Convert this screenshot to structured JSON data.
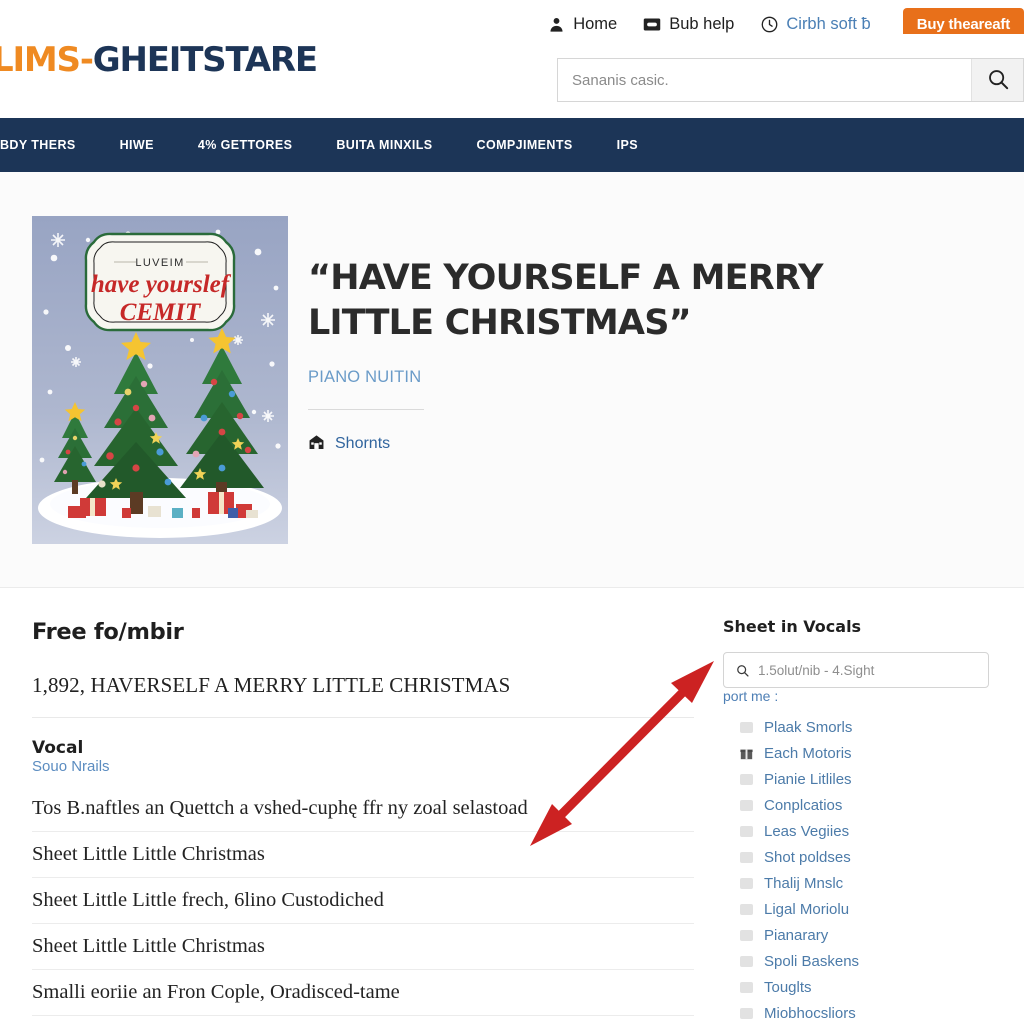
{
  "topbar": {
    "items": [
      {
        "icon": "user-icon",
        "label": "Home",
        "style": "dark"
      },
      {
        "icon": "inbox-icon",
        "label": "Bub help",
        "style": "dark"
      },
      {
        "icon": "clock-icon",
        "label": "Cirbh soft ƀ",
        "style": "link"
      }
    ],
    "buy_button": "Buy theareaft"
  },
  "brand": {
    "logo_prefix": "LIMS-",
    "logo_main": "GHEITSTARE"
  },
  "search": {
    "placeholder": "Sananis casic.",
    "value": "",
    "button_icon": "search-icon"
  },
  "nav": {
    "items": [
      {
        "label": "BDY THERS"
      },
      {
        "label": "HIWE"
      },
      {
        "label": "4% GETTORES"
      },
      {
        "label": "BUITA MINXILS"
      },
      {
        "label": "COMPJIMENTS"
      },
      {
        "label": "IPS"
      }
    ]
  },
  "hero": {
    "cover": {
      "banner_top": "LUVEIM",
      "banner_script_1": "have yourslef",
      "banner_script_2": "CEMIT"
    },
    "title": "“HAVE YOURSELF A MERRY LITTLE CHRISTMAS”",
    "subtitle": "PIANO NUITIN",
    "link": {
      "icon": "store-icon",
      "label": "Shornts"
    }
  },
  "main": {
    "heading": "Free fo/mbir",
    "count_line": "1,892, HAVERSELF A MERRY LITTLE CHRISTMAS",
    "section_heading": "Vocal",
    "section_link": "Souo Nrails",
    "rows": [
      {
        "label": "Tos B.naftles an Quettch a vshed-cuphę ffr ny zoal selastoad"
      },
      {
        "label": "Sheet Little Little Christmas"
      },
      {
        "label": "Sheet Little Little frech, 6lino Custodiched"
      },
      {
        "label": "Sheet Little Little Christmas"
      },
      {
        "label": "Smalli eoriie an Fron Cople, Oradisced-tame"
      }
    ]
  },
  "sidebar": {
    "heading": "Sheet in Vocals",
    "search": {
      "placeholder": "1.5olut/nib - 4.Sight",
      "value": "",
      "icon": "search-icon"
    },
    "note": "port me :",
    "items": [
      {
        "label": "Plaak Smorls",
        "icon": "checkbox-icon"
      },
      {
        "label": "Each Motoris",
        "icon": "gift-icon"
      },
      {
        "label": "Pianie Litliles",
        "icon": "checkbox-icon"
      },
      {
        "label": "Conplcatios",
        "icon": "checkbox-icon"
      },
      {
        "label": "Leas Vegiies",
        "icon": "checkbox-icon"
      },
      {
        "label": "Shot poldses",
        "icon": "checkbox-icon"
      },
      {
        "label": "Thalij Mnslc",
        "icon": "checkbox-icon"
      },
      {
        "label": "Ligal Moriolu",
        "icon": "checkbox-icon"
      },
      {
        "label": "Pianarary",
        "icon": "checkbox-icon"
      },
      {
        "label": "Spoli Baskens",
        "icon": "checkbox-icon"
      },
      {
        "label": "Touglts",
        "icon": "checkbox-icon"
      },
      {
        "label": "Miobhocsliors",
        "icon": "checkbox-icon"
      }
    ]
  },
  "annotation": {
    "arrow_color": "#cc2222",
    "type": "double-headed-arrow"
  },
  "colors": {
    "brand_orange": "#ef8a22",
    "brand_navy": "#1c3557",
    "buy_orange": "#e8701a",
    "link_blue": "#4c7ba9",
    "hero_bg": "#fbfbfb"
  }
}
